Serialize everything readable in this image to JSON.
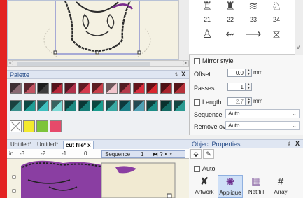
{
  "stitches": [
    {
      "name": "stitch-21",
      "num": "21",
      "glyph": "♖"
    },
    {
      "name": "stitch-22",
      "num": "22",
      "glyph": "♜"
    },
    {
      "name": "stitch-23",
      "num": "23",
      "glyph": "≋"
    },
    {
      "name": "stitch-24",
      "num": "24",
      "glyph": "♘"
    },
    {
      "name": "stitch-25",
      "num": "",
      "glyph": "♙"
    },
    {
      "name": "stitch-26",
      "num": "",
      "glyph": "⇜"
    },
    {
      "name": "stitch-27",
      "num": "",
      "glyph": "⟶"
    },
    {
      "name": "stitch-28",
      "num": "",
      "glyph": "⧖"
    }
  ],
  "props": {
    "mirror_style": "Mirror style",
    "offset_label": "Offset",
    "offset_value": "0.0",
    "offset_unit": "mm",
    "passes_label": "Passes",
    "passes_value": "1",
    "length_label": "Length",
    "length_value": "2.7",
    "length_unit": "mm",
    "sequence_label": "Sequence",
    "sequence_value": "Auto",
    "remove_label": "Remove overlaps",
    "remove_value": "Auto"
  },
  "palette": {
    "title": "Palette",
    "pin": "♯",
    "close": "X",
    "row1": [
      "#8a6b73",
      "#c25563",
      "#3d3d3d",
      "#b8283a",
      "#b0324c",
      "#d63b4e",
      "#c7404b",
      "#f1c5cd",
      "#b53b4b",
      "#d92f3f",
      "#d9262e",
      "#a9232d",
      "#b6313a"
    ],
    "row2": [
      "#3a8f8c",
      "#1f9d95",
      "#3fc0c0",
      "#7bd9d5",
      "#1d8a82",
      "#177d77",
      "#1a9c8e",
      "#3aa9a4",
      "#1c7f87",
      "#4f9fb3",
      "#1c8e87",
      "#136a63",
      "#2b9a92"
    ],
    "tools": [
      "#ffffff",
      "#f3ea2d",
      "#7ec43a",
      "#e64a6a"
    ]
  },
  "doc": {
    "tabs": [
      "Untitled*",
      "Untitled*",
      "cut file*"
    ],
    "tab_close": "x",
    "ruler_unit": "in",
    "ruler_marks": [
      "-3",
      "-2",
      "-1",
      "0",
      "1"
    ],
    "sequence_label": "Sequence",
    "sequence_num": "1",
    "sequence_ctrl": "⧓ ? ‣ ×"
  },
  "object_properties": {
    "title": "Object Properties",
    "pin": "♯",
    "close": "X",
    "auto_label": "Auto",
    "fills": [
      {
        "name": "fill-artwork",
        "label": "Artwork",
        "icon": "✘"
      },
      {
        "name": "fill-applique",
        "label": "Applique",
        "icon": "✺",
        "selected": true
      },
      {
        "name": "fill-netfill",
        "label": "Net fill",
        "icon": "▦"
      },
      {
        "name": "fill-array",
        "label": "Array",
        "icon": "#"
      }
    ]
  },
  "scroll": {
    "left": "<",
    "right": ">",
    "up": "^",
    "down": "v"
  }
}
